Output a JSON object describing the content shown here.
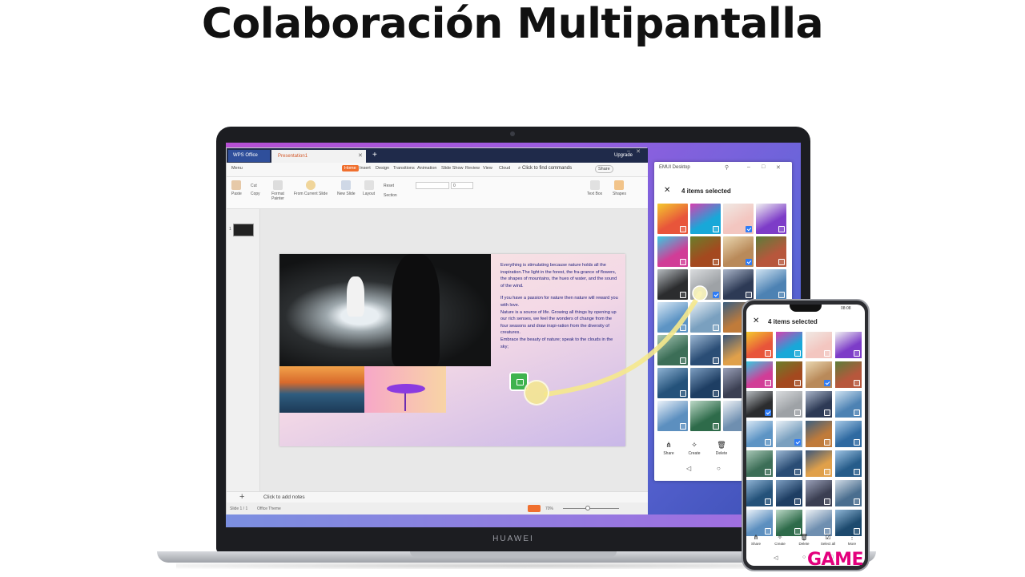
{
  "headline": "Colaboración Multipantalla",
  "laptop": {
    "brand": "HUAWEI"
  },
  "wps": {
    "tabs": {
      "app": "WPS Office",
      "document": "Presentation1",
      "upgrade": "Upgrade"
    },
    "menu": {
      "menu_label": "Menu",
      "items": [
        "Home",
        "Insert",
        "Design",
        "Transitions",
        "Animation",
        "Slide Show",
        "Review",
        "View",
        "Cloud"
      ],
      "active": "Home",
      "find": "Click to find commands",
      "share": "Share"
    },
    "ribbon": {
      "paste": "Paste",
      "cut": "Cut",
      "copy": "Copy",
      "format_painter": "Format Painter",
      "from_current_slide": "From Current Slide",
      "new_slide": "New Slide",
      "layout": "Layout",
      "reset": "Reset",
      "section": "Section",
      "font_size": "0",
      "text_box": "Text Box",
      "shapes": "Shapes"
    },
    "slide_text": {
      "p1": "Everything is stimulating because nature holds all the inspiration.The light in the forest, the fra-grance of flowers, the shapes of mountains, the hues of water, and the sound of the wind.",
      "p2": "If you have a passion for nature then nature will reward you with love.",
      "p3": "Nature is a source of life. Growing all things by opening up our rich senses, we feel the wonders of change from the four seasons and draw inspi-ration from the diversity of creatures.",
      "p4": "Embrace the beauty of nature; speak to the clouds in the sky;"
    },
    "notes_placeholder": "Click to add notes",
    "status": {
      "slide_count": "Slide 1 / 1",
      "theme": "Office Theme",
      "zoom": "70%"
    }
  },
  "emui": {
    "title": "EMUI Desktop",
    "selection": "4 items selected",
    "tools": [
      "Share",
      "Create",
      "Delete"
    ]
  },
  "phone": {
    "status_time": "08:08",
    "selection": "4 items selected",
    "tools": [
      "Share",
      "Create",
      "Delete",
      "Select all",
      "More"
    ]
  },
  "watermark": "GAME",
  "colors": {
    "wps_accent": "#f06f2e",
    "check_blue": "#2f7cf6",
    "game_pink": "#e3007d"
  },
  "gallery": {
    "emui_tiles": [
      {
        "c": "#e8553a",
        "c2": "#f4c92e",
        "checked": false
      },
      {
        "c": "#18a8d8",
        "c2": "#d83fb0",
        "checked": false
      },
      {
        "c": "#f3c6c0",
        "c2": "#f0e9e4",
        "checked": true
      },
      {
        "c": "#7d3cc8",
        "c2": "#f2f2f2",
        "checked": false
      },
      {
        "c": "#d13d97",
        "c2": "#39c9e0",
        "checked": false
      },
      {
        "c": "#a4491f",
        "c2": "#6a7e2a",
        "checked": false
      },
      {
        "c": "#b98a5a",
        "c2": "#e9d7b0",
        "checked": true
      },
      {
        "c": "#b7573c",
        "c2": "#5c7d3a",
        "checked": false
      },
      {
        "c": "#2b2c2e",
        "c2": "#b6bbbf",
        "checked": false
      },
      {
        "c": "#9ea2a6",
        "c2": "#dadcde",
        "checked": true
      },
      {
        "c": "#2d3a55",
        "c2": "#aab5c9",
        "checked": false
      },
      {
        "c": "#4d82b3",
        "c2": "#cfe3f2",
        "checked": false
      },
      {
        "c": "#5d94c4",
        "c2": "#d9e8f5",
        "checked": false
      },
      {
        "c": "#7aa0bf",
        "c2": "#eaf1f7",
        "checked": false
      },
      {
        "c": "#c07b3a",
        "c2": "#3b5f80",
        "checked": false
      },
      {
        "c": "#2f6aa1",
        "c2": "#a7c9e6",
        "checked": false
      },
      {
        "c": "#3c6e57",
        "c2": "#a8c7b6",
        "checked": false
      },
      {
        "c": "#2a4d75",
        "c2": "#9db8d4",
        "checked": false
      },
      {
        "c": "#e0a04a",
        "c2": "#3a567a",
        "checked": false
      },
      {
        "c": "#265c8a",
        "c2": "#9ec3e3",
        "checked": false
      },
      {
        "c": "#24527a",
        "c2": "#8fb3d4",
        "checked": false
      },
      {
        "c": "#1e3e63",
        "c2": "#7e9fc2",
        "checked": false
      },
      {
        "c": "#3b3f52",
        "c2": "#9aa0b8",
        "checked": false
      },
      {
        "c": "#4a6e8f",
        "c2": "#d0dbe6",
        "checked": false
      },
      {
        "c": "#5c8fbf",
        "c2": "#ecf3fa",
        "checked": false
      },
      {
        "c": "#2e6b4a",
        "c2": "#bcd9c7",
        "checked": false
      },
      {
        "c": "#6f8fb0",
        "c2": "#eef2f6",
        "checked": false
      },
      {
        "c": "#1d4a6e",
        "c2": "#8fb6d6",
        "checked": false
      }
    ],
    "phone_tiles": [
      {
        "c": "#e8553a",
        "c2": "#f4c92e",
        "checked": false
      },
      {
        "c": "#18a8d8",
        "c2": "#d83fb0",
        "checked": false
      },
      {
        "c": "#f3c6c0",
        "c2": "#f0e9e4",
        "checked": false
      },
      {
        "c": "#7d3cc8",
        "c2": "#f2f2f2",
        "checked": false
      },
      {
        "c": "#d13d97",
        "c2": "#39c9e0",
        "checked": false
      },
      {
        "c": "#a4491f",
        "c2": "#6a7e2a",
        "checked": false
      },
      {
        "c": "#b98a5a",
        "c2": "#e9d7b0",
        "checked": true
      },
      {
        "c": "#b7573c",
        "c2": "#5c7d3a",
        "checked": false
      },
      {
        "c": "#2b2c2e",
        "c2": "#b6bbbf",
        "checked": true
      },
      {
        "c": "#9ea2a6",
        "c2": "#dadcde",
        "checked": false
      },
      {
        "c": "#2d3a55",
        "c2": "#aab5c9",
        "checked": false
      },
      {
        "c": "#4d82b3",
        "c2": "#cfe3f2",
        "checked": false
      },
      {
        "c": "#5d94c4",
        "c2": "#d9e8f5",
        "checked": false
      },
      {
        "c": "#7aa0bf",
        "c2": "#eaf1f7",
        "checked": true
      },
      {
        "c": "#c07b3a",
        "c2": "#3b5f80",
        "checked": false
      },
      {
        "c": "#2f6aa1",
        "c2": "#a7c9e6",
        "checked": false
      },
      {
        "c": "#3c6e57",
        "c2": "#a8c7b6",
        "checked": false
      },
      {
        "c": "#2a4d75",
        "c2": "#9db8d4",
        "checked": false
      },
      {
        "c": "#e0a04a",
        "c2": "#3a567a",
        "checked": false
      },
      {
        "c": "#265c8a",
        "c2": "#9ec3e3",
        "checked": false
      },
      {
        "c": "#24527a",
        "c2": "#8fb3d4",
        "checked": false
      },
      {
        "c": "#1e3e63",
        "c2": "#7e9fc2",
        "checked": false
      },
      {
        "c": "#3b3f52",
        "c2": "#9aa0b8",
        "checked": false
      },
      {
        "c": "#4a6e8f",
        "c2": "#d0dbe6",
        "checked": false
      },
      {
        "c": "#5c8fbf",
        "c2": "#ecf3fa",
        "checked": false
      },
      {
        "c": "#2e6b4a",
        "c2": "#bcd9c7",
        "checked": false
      },
      {
        "c": "#6f8fb0",
        "c2": "#eef2f6",
        "checked": false
      },
      {
        "c": "#1d4a6e",
        "c2": "#8fb6d6",
        "checked": false
      }
    ]
  }
}
